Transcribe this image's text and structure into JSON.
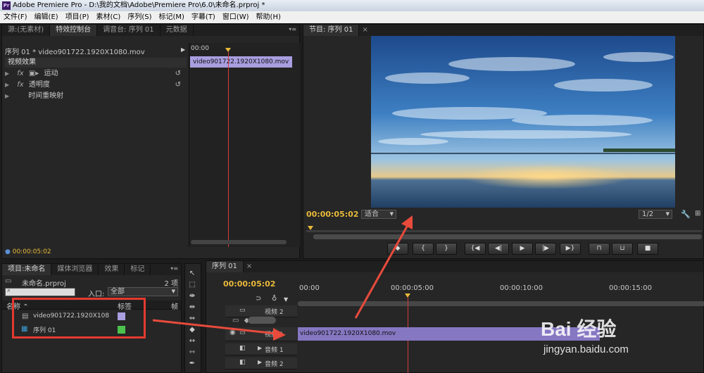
{
  "title_bar": {
    "text": "Adobe Premiere Pro - D:\\我的文档\\Adobe\\Premiere Pro\\6.0\\未命名.prproj *",
    "logo": "Pr"
  },
  "menu": [
    "文件(F)",
    "编辑(E)",
    "项目(P)",
    "素材(C)",
    "序列(S)",
    "标记(M)",
    "字幕(T)",
    "窗口(W)",
    "帮助(H)"
  ],
  "source_panel": {
    "tabs": [
      "源:(无素材)",
      "特效控制台",
      "调音台: 序列 01",
      "元数据"
    ],
    "clip_header": "序列 01 * video901722.1920X1080.mov",
    "timeline_start": "00:00",
    "clip_name": "video901722.1920X1080.mov",
    "section_label": "视频效果",
    "effects": [
      "运动",
      "透明度",
      "时间重映射"
    ],
    "timecode": "00:00:05:02"
  },
  "program_monitor": {
    "tab": "节目: 序列 01",
    "timecode": "00:00:05:02",
    "fit": "适合",
    "resolution": "1/2"
  },
  "project_panel": {
    "tabs": [
      "项目:未命名",
      "媒体浏览器",
      "效果",
      "标记"
    ],
    "project_file": "未命名.prproj",
    "item_count": "2 项",
    "search_placeholder": "",
    "entry_label": "入口:",
    "entry_value": "全部",
    "col_name": "名称",
    "col_label": "标签",
    "col_frame": "帧",
    "items": [
      {
        "name": "video901722.1920X1080.mov",
        "color": "#a99ee0"
      },
      {
        "name": "序列 01",
        "color": "#4cc14c"
      }
    ]
  },
  "timeline": {
    "tab": "序列 01",
    "timecode": "00:00:05:02",
    "ruler": [
      "00:00",
      "00:00:05:00",
      "00:00:10:00",
      "00:00:15:00"
    ],
    "tracks": [
      {
        "label": "视频 2",
        "kind": "video"
      },
      {
        "label": "视频 1",
        "kind": "video"
      },
      {
        "label": "音频 1",
        "kind": "audio"
      },
      {
        "label": "音频 2",
        "kind": "audio"
      }
    ],
    "clip_name": "video901722.1920X1080.mov"
  },
  "watermark": {
    "text": "Bai 经验",
    "url": "jingyan.baidu.com"
  }
}
